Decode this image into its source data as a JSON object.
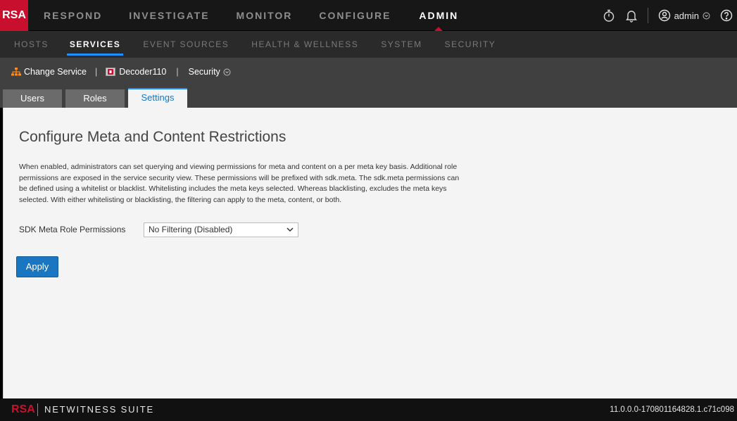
{
  "brand": {
    "logo": "RSA",
    "footer_logo": "RSA",
    "footer_name": "NETWITNESS SUITE",
    "version": "11.0.0.0-170801164828.1.c71c098"
  },
  "topnav": {
    "items": [
      "RESPOND",
      "INVESTIGATE",
      "MONITOR",
      "CONFIGURE",
      "ADMIN"
    ],
    "active": "ADMIN"
  },
  "user": {
    "name": "admin"
  },
  "icons": [
    "stopwatch-icon",
    "bell-icon",
    "user-icon",
    "chevron-down-icon",
    "help-icon",
    "org-chart-icon",
    "decoder-icon"
  ],
  "subnav": {
    "items": [
      "HOSTS",
      "SERVICES",
      "EVENT SOURCES",
      "HEALTH & WELLNESS",
      "SYSTEM",
      "SECURITY"
    ],
    "active": "SERVICES"
  },
  "servicebar": {
    "change_service": "Change Service",
    "service_name": "Decoder110",
    "view": "Security"
  },
  "tabs": {
    "items": [
      "Users",
      "Roles",
      "Settings"
    ],
    "active": "Settings"
  },
  "content": {
    "title": "Configure Meta and Content Restrictions",
    "description_lines": [
      "When enabled, administrators can set querying and viewing permissions for meta and content on a per meta key basis. Additional role",
      "permissions are exposed in the service security view. These permissions will be prefixed with sdk.meta. The sdk.meta permissions can",
      "be defined using a whitelist or blacklist. Whitelisting includes the meta keys selected. Whereas blacklisting, excludes the meta keys",
      "selected. With either whitelisting or blacklisting, the filtering can apply to the meta, content, or both."
    ],
    "permission_label": "SDK Meta Role Permissions",
    "permission_value": "No Filtering (Disabled)",
    "apply_label": "Apply"
  },
  "colors": {
    "brand_red": "#c8102e",
    "accent_blue": "#1a76c1",
    "topnav_bg": "#171717",
    "subnav_bg": "#2a2a2a",
    "bar_bg": "#404040",
    "content_bg": "#f4f4f4"
  }
}
